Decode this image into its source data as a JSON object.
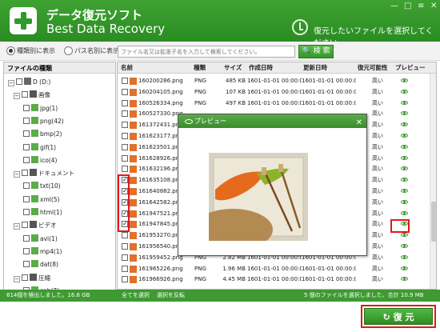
{
  "app": {
    "title_ja": "データ復元ソフト",
    "title_en": "Best Data Recovery",
    "hint": "復元したいファイルを選択してください"
  },
  "view": {
    "opt_type": "種類別に表示",
    "opt_path": "パス名別に表示",
    "search_placeholder": "ファイル名又は拡張子名を入力して検索してください。",
    "search_button": "検 索"
  },
  "tree": {
    "header": "ファイルの種類",
    "nodes": [
      {
        "label": "D (D:)",
        "kind": "drive"
      },
      {
        "label": "画像",
        "kind": "cat"
      },
      {
        "label": "jpg(1)",
        "kind": "leaf"
      },
      {
        "label": "png(42)",
        "kind": "leaf"
      },
      {
        "label": "bmp(2)",
        "kind": "leaf"
      },
      {
        "label": "gif(1)",
        "kind": "leaf"
      },
      {
        "label": "ico(4)",
        "kind": "leaf"
      },
      {
        "label": "ドキュメント",
        "kind": "cat"
      },
      {
        "label": "txt(10)",
        "kind": "leaf"
      },
      {
        "label": "xml(5)",
        "kind": "leaf"
      },
      {
        "label": "html(1)",
        "kind": "leaf"
      },
      {
        "label": "ビデオ",
        "kind": "cat"
      },
      {
        "label": "avi(1)",
        "kind": "leaf"
      },
      {
        "label": "mp4(1)",
        "kind": "leaf"
      },
      {
        "label": "dat(8)",
        "kind": "leaf"
      },
      {
        "label": "圧縮",
        "kind": "cat"
      },
      {
        "label": "cab(7)",
        "kind": "leaf"
      }
    ]
  },
  "table": {
    "headers": [
      "名前",
      "種類",
      "サイズ",
      "作成日時",
      "更新日時",
      "復元可能性",
      "プレビュー"
    ],
    "rows": [
      {
        "name": "160200286.png",
        "type": "PNG",
        "size": "485 KB",
        "created": "1601-01-01 00:00:00",
        "updated": "1601-01-01 00:00:00",
        "rec": "高い",
        "checked": false
      },
      {
        "name": "160204105.png",
        "type": "PNG",
        "size": "107 KB",
        "created": "1601-01-01 00:00:00",
        "updated": "1601-01-01 00:00:00",
        "rec": "高い",
        "checked": false
      },
      {
        "name": "160526334.png",
        "type": "PNG",
        "size": "497 KB",
        "created": "1601-01-01 00:00:00",
        "updated": "1601-01-01 00:00:00",
        "rec": "高い",
        "checked": false
      },
      {
        "name": "160527330.png",
        "type": "",
        "size": "",
        "created": "",
        "updated": "",
        "rec": "高い",
        "checked": false
      },
      {
        "name": "161372431.png",
        "type": "",
        "size": "",
        "created": "",
        "updated": "",
        "rec": "高い",
        "checked": false
      },
      {
        "name": "161623177.png",
        "type": "",
        "size": "",
        "created": "",
        "updated": "",
        "rec": "高い",
        "checked": false
      },
      {
        "name": "161623501.png",
        "type": "",
        "size": "",
        "created": "",
        "updated": "",
        "rec": "高い",
        "checked": false
      },
      {
        "name": "161628926.png",
        "type": "",
        "size": "",
        "created": "",
        "updated": "",
        "rec": "高い",
        "checked": false
      },
      {
        "name": "161632196.png",
        "type": "",
        "size": "",
        "created": "",
        "updated": "",
        "rec": "高い",
        "checked": false
      },
      {
        "name": "161635108.png",
        "type": "",
        "size": "",
        "created": "",
        "updated": "",
        "rec": "高い",
        "checked": true
      },
      {
        "name": "161640882.png",
        "type": "",
        "size": "",
        "created": "",
        "updated": "",
        "rec": "高い",
        "checked": true
      },
      {
        "name": "161642582.png",
        "type": "",
        "size": "",
        "created": "",
        "updated": "",
        "rec": "高い",
        "checked": true
      },
      {
        "name": "161947521.png",
        "type": "",
        "size": "",
        "created": "",
        "updated": "",
        "rec": "高い",
        "checked": true
      },
      {
        "name": "161947845.png",
        "type": "",
        "size": "",
        "created": "",
        "updated": "",
        "rec": "高い",
        "checked": true
      },
      {
        "name": "161953270.png",
        "type": "",
        "size": "",
        "created": "",
        "updated": "",
        "rec": "高い",
        "checked": false
      },
      {
        "name": "161956540.png",
        "type": "",
        "size": "",
        "created": "",
        "updated": "",
        "rec": "高い",
        "checked": false
      },
      {
        "name": "161959452.png",
        "type": "PNG",
        "size": "2.82 MB",
        "created": "1601-01-01 00:00:00",
        "updated": "1601-01-01 00:00:00",
        "rec": "高い",
        "checked": false
      },
      {
        "name": "161965226.png",
        "type": "PNG",
        "size": "1.96 MB",
        "created": "1601-01-01 00:00:00",
        "updated": "1601-01-01 00:00:00",
        "rec": "高い",
        "checked": false
      },
      {
        "name": "161966926.png",
        "type": "PNG",
        "size": "4.45 MB",
        "created": "1601-01-01 00:00:00",
        "updated": "1601-01-01 00:00:00",
        "rec": "高い",
        "checked": false
      }
    ]
  },
  "status": {
    "found": "614個を検出しました。16.6 GB",
    "select_all": "全てを選択",
    "invert": "選択を反転",
    "selected": "5 個のファイルを選択しました、合計 10.9 MB"
  },
  "preview": {
    "title": "プレビュー",
    "close": "✕"
  },
  "recover": {
    "label": "復 元"
  },
  "colors": {
    "brand": "#3e9a31",
    "highlight": "#e0191e"
  }
}
